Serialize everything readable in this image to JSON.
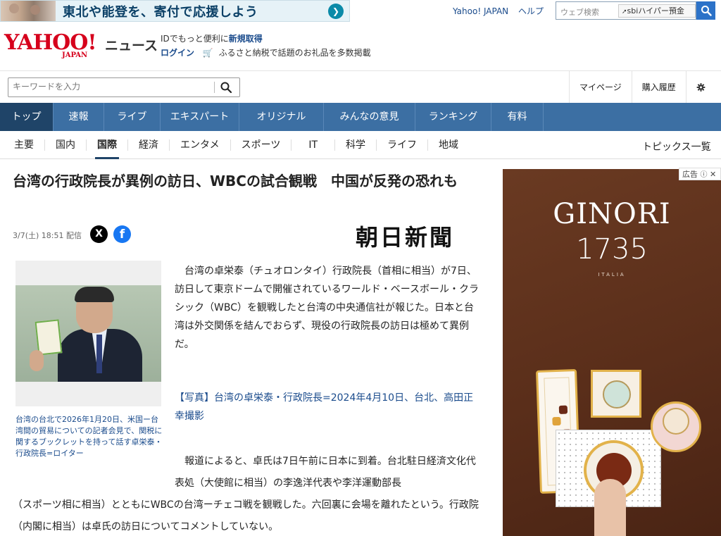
{
  "promo": {
    "text": "東北や能登を、寄付で応援しよう",
    "arrow": "❯"
  },
  "toplinks": {
    "yahoo_japan": "Yahoo! JAPAN",
    "help": "ヘルプ"
  },
  "websearch": {
    "placeholder": "ウェブ検索",
    "sbi_label": "sbiハイパー預金"
  },
  "header": {
    "logo": "YAHOO!",
    "logo_sub": "JAPAN",
    "section": "ニュース",
    "id_prefix": "IDでもっと便利に",
    "id_register": "新規取得",
    "login": "ログイン",
    "furusato": "ふるさと納税で話題のお礼品を多数掲載"
  },
  "search": {
    "placeholder": "キーワードを入力"
  },
  "rightlinks": {
    "mypage": "マイページ",
    "history": "購入履歴"
  },
  "mainnav": [
    {
      "label": "トップ",
      "active": true
    },
    {
      "label": "速報"
    },
    {
      "label": "ライブ"
    },
    {
      "label": "エキスパート"
    },
    {
      "label": "オリジナル"
    },
    {
      "label": "みんなの意見"
    },
    {
      "label": "ランキング"
    },
    {
      "label": "有料"
    }
  ],
  "subnav": [
    {
      "label": "主要"
    },
    {
      "label": "国内"
    },
    {
      "label": "国際",
      "active": true
    },
    {
      "label": "経済"
    },
    {
      "label": "エンタメ"
    },
    {
      "label": "スポーツ"
    },
    {
      "label": "IT"
    },
    {
      "label": "科学"
    },
    {
      "label": "ライフ"
    },
    {
      "label": "地域"
    }
  ],
  "subnav_topics": "トピックス一覧",
  "article": {
    "headline": "台湾の行政院長が異例の訪日、WBCの試合観戦　中国が反発の恐れも",
    "date": "3/7(土) 18:51",
    "delivery": "配信",
    "share_x": "X",
    "share_fb": "f",
    "publisher": "朝日新聞",
    "photo_caption": "台湾の台北で2026年1月20日、米国ー台湾間の貿易についての記者会見で、関税に関するブックレットを持って話す卓栄泰・行政院長=ロイター",
    "body1": "台湾の卓栄泰（チュオロンタイ）行政院長（首相に相当）が7日、訪日して東京ドームで開催されているワールド・ベースボール・クラシック（WBC）を観戦したと台湾の中央通信社が報じた。日本と台湾は外交関係を結んでおらず、現役の行政院長の訪日は極めて異例だ。",
    "photo_link": "【写真】台湾の卓栄泰・行政院長=2024年4月10日、台北、高田正幸撮影",
    "body2": "報道によると、卓氏は7日午前に日本に到着。台北駐日経済文化代表処（大使館に相当）の李逸洋代表や李洋運動部長",
    "body3": "（スポーツ相に相当）とともにWBCの台湾ーチェコ戦を観戦した。六回裏に会場を離れたという。行政院（内閣に相当）は卓氏の訪日についてコメントしていない。"
  },
  "ad": {
    "label": "広告",
    "brand_line1": "GINORI",
    "brand_line2": "1735",
    "brand_sub": "ITALIA"
  }
}
